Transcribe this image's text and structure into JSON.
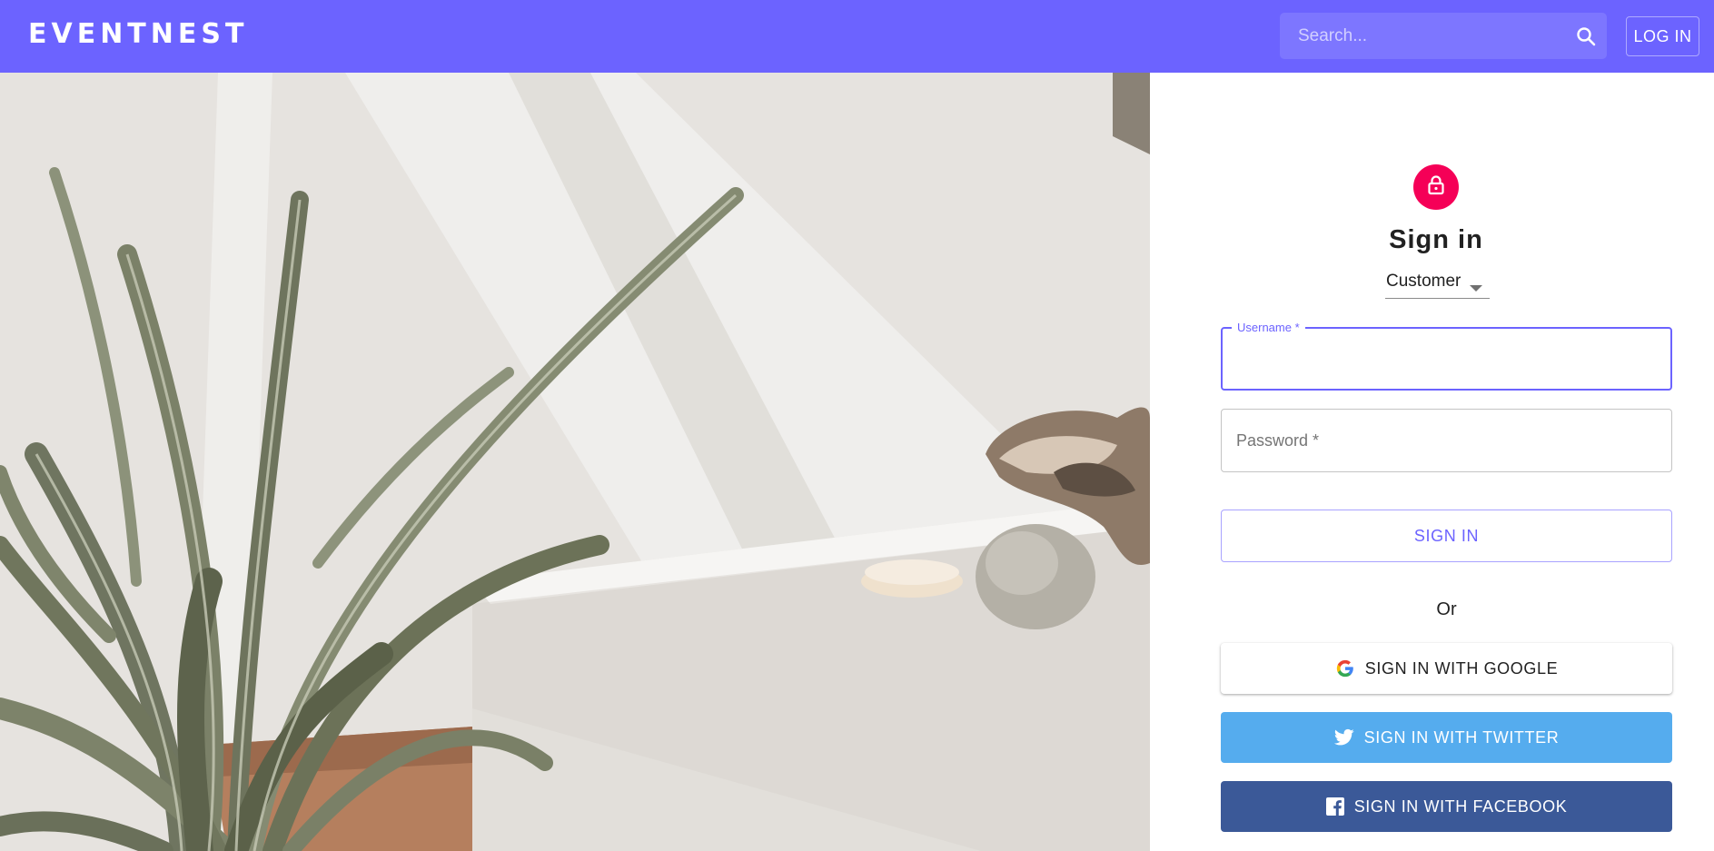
{
  "app": {
    "brand": "EVENTNEST",
    "accent_color": "#6c63ff"
  },
  "header": {
    "search_placeholder": "Search...",
    "search_icon": "search-icon",
    "login_label": "LOG IN"
  },
  "hero": {
    "image_subject": "potted plant beside white cabinet with glass vase"
  },
  "signin": {
    "avatar_icon": "lock-icon",
    "avatar_color": "#f50057",
    "title": "Sign in",
    "role": {
      "selected": "Customer"
    },
    "username": {
      "label": "Username *",
      "value": ""
    },
    "password": {
      "placeholder": "Password *",
      "value": ""
    },
    "submit_label": "SIGN IN",
    "or_text": "Or",
    "social": {
      "google_label": "SIGN IN WITH GOOGLE",
      "google_icon": "google-icon",
      "twitter_label": "SIGN IN WITH TWITTER",
      "twitter_icon": "twitter-icon",
      "twitter_color": "#55acee",
      "facebook_label": "SIGN IN WITH FACEBOOK",
      "facebook_icon": "facebook-icon",
      "facebook_color": "#3b5998"
    }
  }
}
